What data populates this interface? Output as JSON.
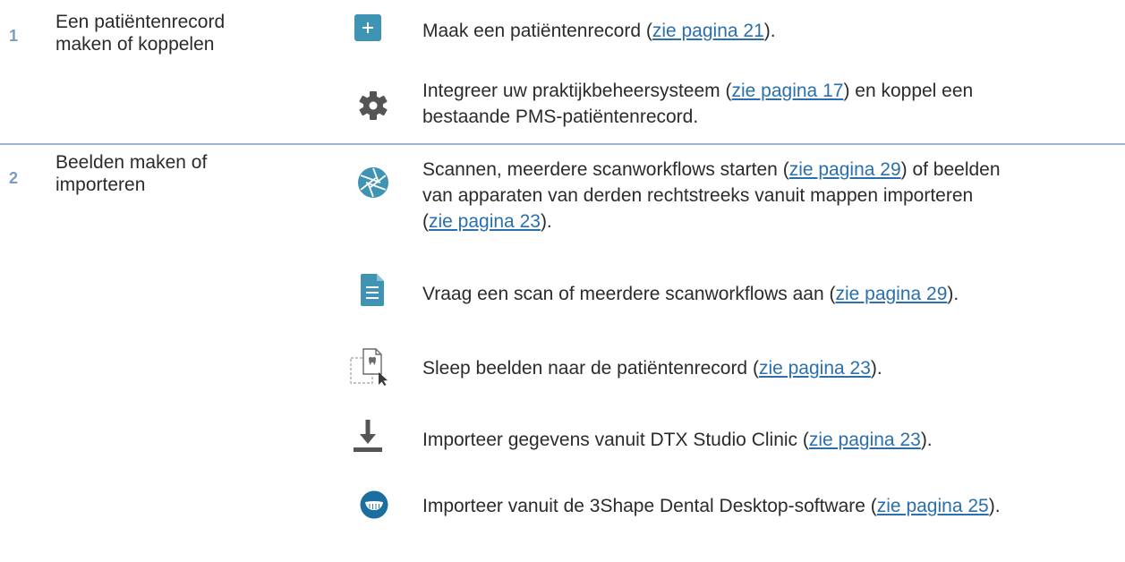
{
  "steps": [
    {
      "number": "1",
      "title_line1": "Een patiëntenrecord",
      "title_line2": "maken of koppelen"
    },
    {
      "number": "2",
      "title_line1": "Beelden maken of",
      "title_line2": "importeren"
    }
  ],
  "rows": [
    {
      "icon": "plus-icon",
      "l1_pre": "Maak een patiëntenrecord (",
      "l1_link": "zie pagina 21",
      "l1_post": ")."
    },
    {
      "icon": "gear-icon",
      "l1_pre": "Integreer uw praktijkbeheersysteem (",
      "l1_link": "zie pagina 17",
      "l1_post": ") en koppel een",
      "l2": "bestaande PMS-patiëntenrecord."
    },
    {
      "icon": "aperture-icon",
      "l1_pre": "Scannen, meerdere scanworkflows starten (",
      "l1_link": "zie pagina 29",
      "l1_post": ") of beelden",
      "l2": "van apparaten van derden rechtstreeks vanuit mappen importeren",
      "l3_pre": "(",
      "l3_link": "zie pagina 23",
      "l3_post": ")."
    },
    {
      "icon": "document-icon",
      "l1_pre": "Vraag een scan of meerdere scanworkflows aan (",
      "l1_link": "zie pagina 29",
      "l1_post": ")."
    },
    {
      "icon": "drag-image-icon",
      "l1_pre": "Sleep beelden naar de patiëntenrecord (",
      "l1_link": "zie pagina 23",
      "l1_post": ")."
    },
    {
      "icon": "download-icon",
      "l1_pre": "Importeer gegevens vanuit DTX Studio Clinic (",
      "l1_link": "zie pagina 23",
      "l1_post": ")."
    },
    {
      "icon": "dental-scan-icon",
      "l1_pre": "Importeer vanuit de 3Shape Dental Desktop-software (",
      "l1_link": "zie pagina 25",
      "l1_post": ")."
    }
  ],
  "colors": {
    "accent": "#3f93b3",
    "link": "#2a6fae",
    "step_number": "#7a9cc0",
    "divider": "#9bb5d1",
    "icon_gray": "#555555"
  }
}
